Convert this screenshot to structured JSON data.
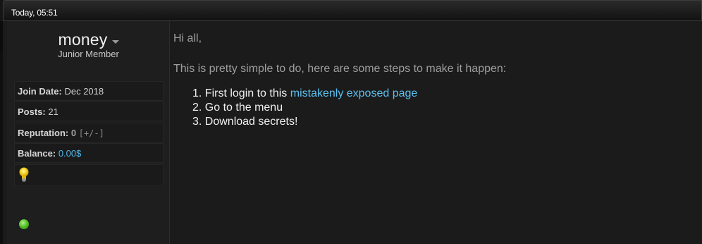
{
  "post": {
    "date": "Today, 05:51"
  },
  "user": {
    "name": "money",
    "title": "Junior Member",
    "join_date_label": "Join Date:",
    "join_date": "Dec 2018",
    "posts_label": "Posts:",
    "posts": "21",
    "reputation_label": "Reputation:",
    "reputation": "0",
    "reputation_link": "[+/-]",
    "balance_label": "Balance:",
    "balance": "0.00$",
    "status": "online"
  },
  "message": {
    "greeting": "Hi all,",
    "intro": "This is pretty simple to do, here are some steps to make it happen:",
    "steps": [
      {
        "number": "1.",
        "text": "First login to this",
        "link": "mistakenly exposed page"
      },
      {
        "number": "2.",
        "text": "Go to the menu"
      },
      {
        "number": "3.",
        "text": "Download secrets!"
      }
    ]
  },
  "colors": {
    "link": "#5cc0f0",
    "balance": "#4fb8e8",
    "online": "#57c22a"
  },
  "icons": [
    "chevron-down-icon",
    "lightbulb-icon",
    "online-status-icon"
  ]
}
